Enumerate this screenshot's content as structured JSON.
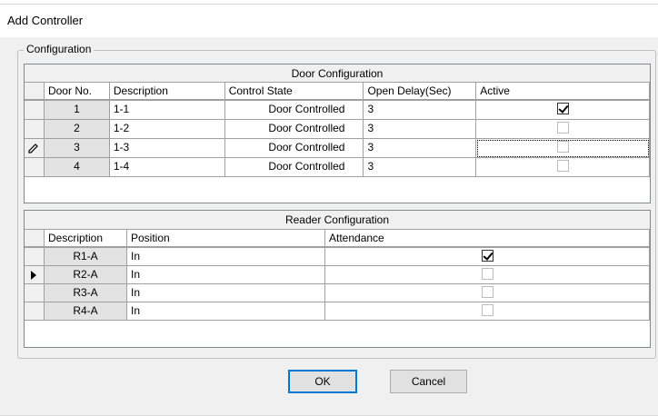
{
  "window": {
    "title": "Add Controller"
  },
  "configuration": {
    "legend": "Configuration"
  },
  "door_grid": {
    "title": "Door Configuration",
    "columns": [
      "Door No.",
      "Description",
      "Control State",
      "Open Delay(Sec)",
      "Active"
    ],
    "rows": [
      {
        "door_no": "1",
        "description": "1-1",
        "control_state": "Door Controlled",
        "open_delay": "3",
        "active": true,
        "indicator": ""
      },
      {
        "door_no": "2",
        "description": "1-2",
        "control_state": "Door Controlled",
        "open_delay": "3",
        "active": false,
        "indicator": ""
      },
      {
        "door_no": "3",
        "description": "1-3",
        "control_state": "Door Controlled",
        "open_delay": "3",
        "active": false,
        "indicator": "edit-pencil"
      },
      {
        "door_no": "4",
        "description": "1-4",
        "control_state": "Door Controlled",
        "open_delay": "3",
        "active": false,
        "indicator": ""
      }
    ]
  },
  "reader_grid": {
    "title": "Reader Configuration",
    "columns": [
      "Description",
      "Position",
      "Attendance"
    ],
    "rows": [
      {
        "description": "R1-A",
        "position": "In",
        "attendance": true,
        "indicator": ""
      },
      {
        "description": "R2-A",
        "position": "In",
        "attendance": false,
        "indicator": "current-row-arrow"
      },
      {
        "description": "R3-A",
        "position": "In",
        "attendance": false,
        "indicator": ""
      },
      {
        "description": "R4-A",
        "position": "In",
        "attendance": false,
        "indicator": ""
      }
    ]
  },
  "buttons": {
    "ok": "OK",
    "cancel": "Cancel"
  },
  "colors": {
    "accent": "#0078d7",
    "window_bg": "#f0f0f0",
    "grid_line": "#a0a0a0",
    "readonly_cell": "#e3e3e3"
  }
}
